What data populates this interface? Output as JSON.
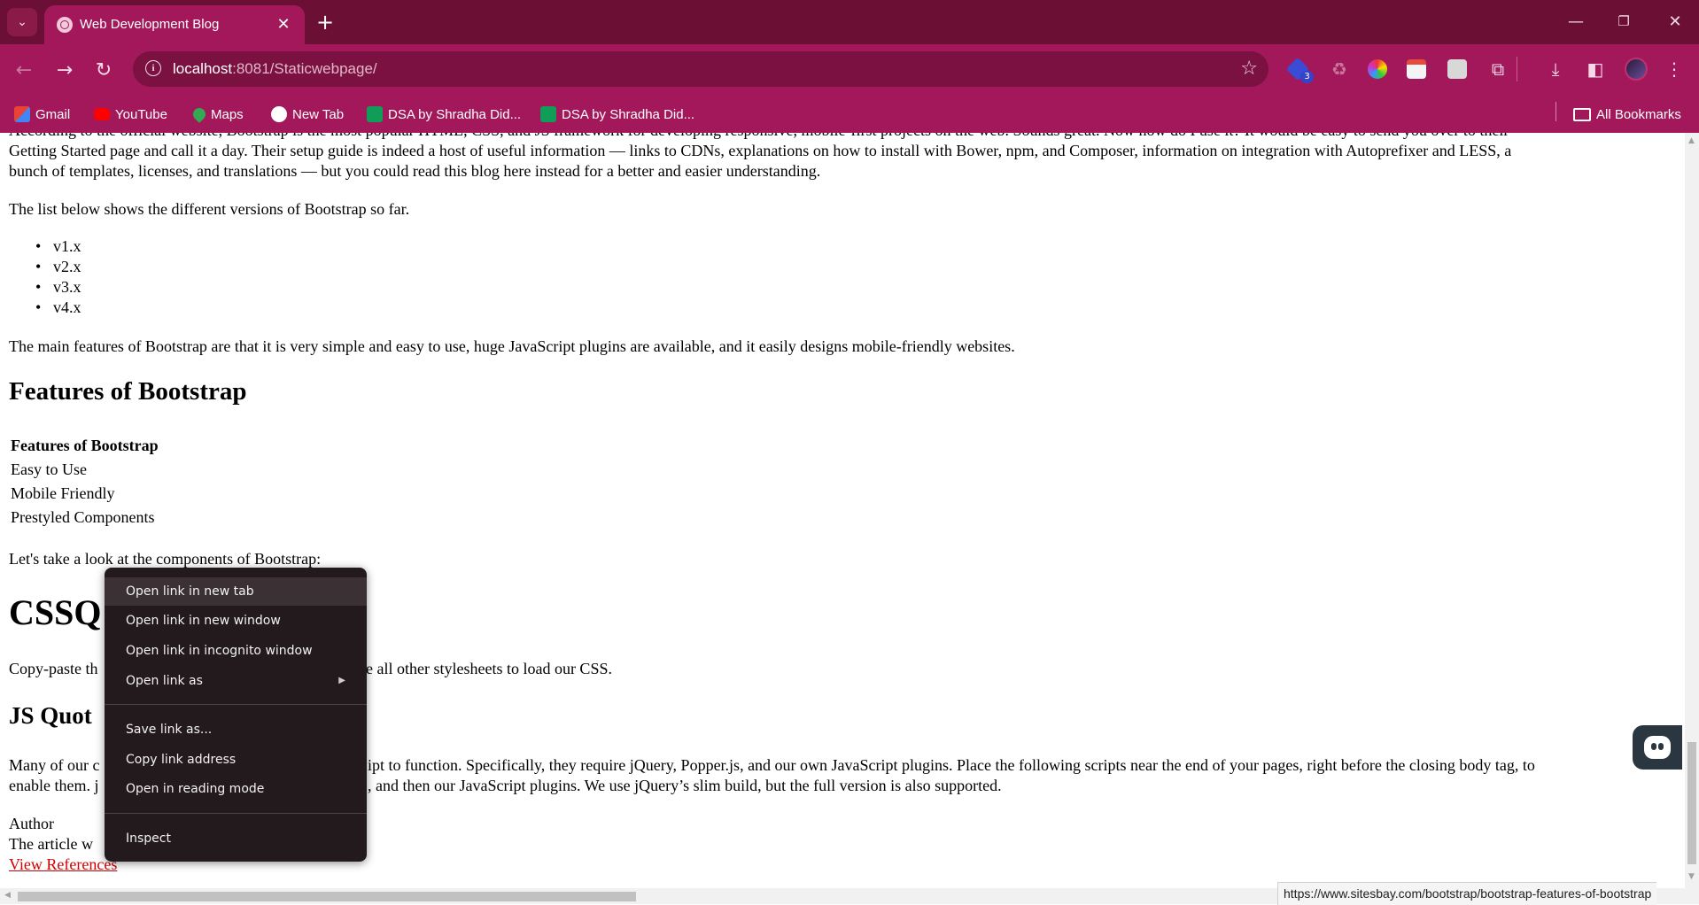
{
  "browser": {
    "tab": {
      "title": "Web Development Blog"
    },
    "url": {
      "host": "localhost",
      "rest": ":8081/Staticwebpage/"
    },
    "extension_badge": "3",
    "bookmarks": [
      "Gmail",
      "YouTube",
      "Maps",
      "New Tab",
      "DSA by Shradha Did...",
      "DSA by Shradha Did..."
    ],
    "all_bookmarks": "All Bookmarks",
    "colors": {
      "frame": "#6b0f35",
      "toolbar": "#a3185a"
    }
  },
  "page": {
    "intro_lines": [
      "According to the official website, Bootstrap is the most popular HTML, CSS, and JS framework for developing responsive, mobile-first projects on the web. Sounds great. Now how do I use it? It would be easy to send you over to their",
      "Getting Started page and call it a day. Their setup guide is indeed a host of useful information — links to CDNs, explanations on how to install with Bower, npm, and Composer, information on integration with Autoprefixer and LESS, a",
      "bunch of templates, licenses, and translations — but you could read this blog here instead for a better and easier understanding."
    ],
    "versions_intro": "The list below shows the different versions of Bootstrap so far.",
    "versions": [
      "v1.x",
      "v2.x",
      "v3.x",
      "v4.x"
    ],
    "main_features": "The main features of Bootstrap are that it is very simple and easy to use, huge JavaScript plugins are available, and it easily designs mobile-friendly websites.",
    "features_heading": "Features of Bootstrap",
    "table": {
      "header": "Features of Bootstrap",
      "rows": [
        "Easy to Use",
        "Mobile Friendly",
        "Prestyled Components"
      ]
    },
    "components_intro": "Let's take a look at the components of Bootstrap:",
    "css_heading": "CSSQ",
    "css_para_left": "Copy-paste th",
    "css_para_right": "e all other stylesheets to load our CSS.",
    "js_heading": "JS Quot",
    "js_line1_left": "Many of our c",
    "js_line1_right": "ipt to function. Specifically, they require jQuery, Popper.js, and our own JavaScript plugins. Place the following scripts near the end of your pages, right before the closing body tag, to",
    "js_line2_left": "enable them. j",
    "js_line2_right": ", and then our JavaScript plugins. We use jQuery’s slim build, but the full version is also supported.",
    "author_label": "Author",
    "article_text": "The article w",
    "view_references": "View References",
    "status_url": "https://www.sitesbay.com/bootstrap/bootstrap-features-of-bootstrap"
  },
  "context_menu": {
    "items": [
      "Open link in new tab",
      "Open link in new window",
      "Open link in incognito window",
      "Open link as",
      "Save link as...",
      "Copy link address",
      "Open in reading mode",
      "Inspect"
    ]
  }
}
